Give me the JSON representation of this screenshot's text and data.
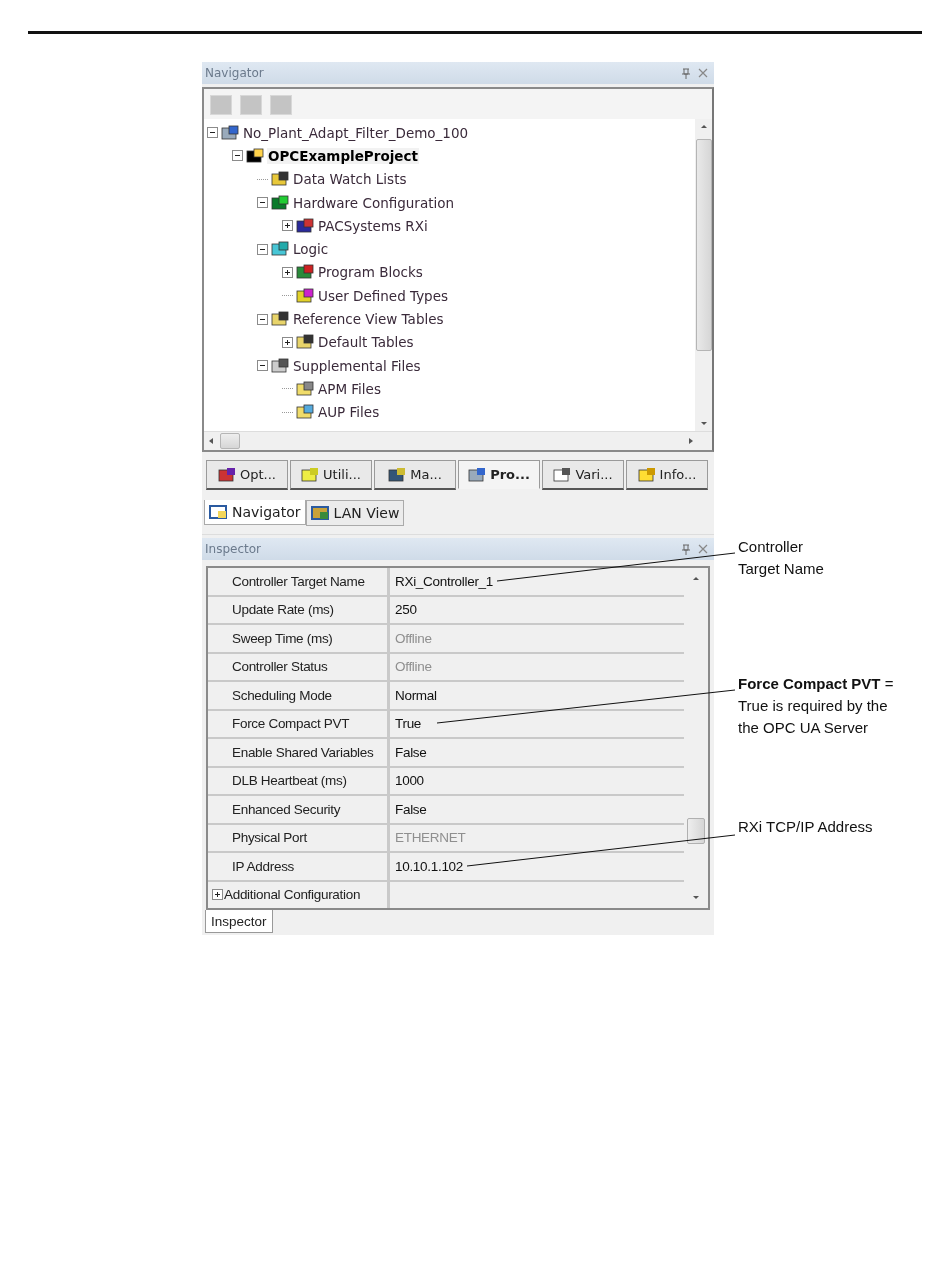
{
  "navigator": {
    "title": "Navigator",
    "toolbar": [
      {
        "disabled": true
      },
      {
        "disabled": true
      },
      {
        "disabled": true
      }
    ],
    "tree": [
      {
        "label": "No_Plant_Adapt_Filter_Demo_100",
        "expanded": true,
        "children": [
          {
            "label": "OPCExampleProject",
            "expanded": true,
            "active": true,
            "children": [
              {
                "label": "Data Watch Lists"
              },
              {
                "label": "Hardware Configuration",
                "expanded": true,
                "children": [
                  {
                    "label": "PACSystems RXi",
                    "expanded": false
                  }
                ]
              },
              {
                "label": "Logic",
                "expanded": true,
                "children": [
                  {
                    "label": "Program Blocks",
                    "expanded": false
                  },
                  {
                    "label": "User Defined Types"
                  }
                ]
              },
              {
                "label": "Reference View Tables",
                "expanded": true,
                "children": [
                  {
                    "label": "Default Tables",
                    "expanded": false
                  }
                ]
              },
              {
                "label": "Supplemental Files",
                "expanded": true,
                "children": [
                  {
                    "label": "APM Files"
                  },
                  {
                    "label": "AUP Files"
                  }
                ]
              }
            ]
          }
        ]
      }
    ],
    "tabs": [
      {
        "label": "Opt...",
        "selected": false
      },
      {
        "label": "Utili...",
        "selected": false
      },
      {
        "label": "Ma...",
        "selected": false
      },
      {
        "label": "Pro...",
        "selected": true
      },
      {
        "label": "Vari...",
        "selected": false
      },
      {
        "label": "Info...",
        "selected": false
      }
    ],
    "view_tabs": [
      {
        "label": "Navigator",
        "selected": true
      },
      {
        "label": "LAN View",
        "selected": false
      }
    ]
  },
  "inspector": {
    "title": "Inspector",
    "rows": [
      {
        "label": "Controller Target Name",
        "value": "RXi_Controller_1",
        "disabled": false
      },
      {
        "label": "Update Rate (ms)",
        "value": "250",
        "disabled": false
      },
      {
        "label": "Sweep Time (ms)",
        "value": "Offline",
        "disabled": true
      },
      {
        "label": "Controller Status",
        "value": "Offline",
        "disabled": true
      },
      {
        "label": "Scheduling Mode",
        "value": "Normal",
        "disabled": false
      },
      {
        "label": "Force Compact PVT",
        "value": "True",
        "disabled": false
      },
      {
        "label": "Enable Shared Variables",
        "value": "False",
        "disabled": false
      },
      {
        "label": "DLB Heartbeat (ms)",
        "value": "1000",
        "disabled": false
      },
      {
        "label": "Enhanced Security",
        "value": "False",
        "disabled": false
      },
      {
        "label": "Physical Port",
        "value": "ETHERNET",
        "disabled": true
      },
      {
        "label": "IP Address",
        "value": "10.10.1.102",
        "disabled": false
      }
    ],
    "group": {
      "label": "Additional Configuration",
      "expanded": false
    },
    "tabs": [
      {
        "label": "Inspector",
        "selected": true
      }
    ]
  },
  "callouts": [
    {
      "text": "Controller Target Name"
    },
    {
      "text": "**Force Compact PVT** = True is required by the the OPC UA Server"
    },
    {
      "text": "RXi TCP/IP Address"
    }
  ]
}
